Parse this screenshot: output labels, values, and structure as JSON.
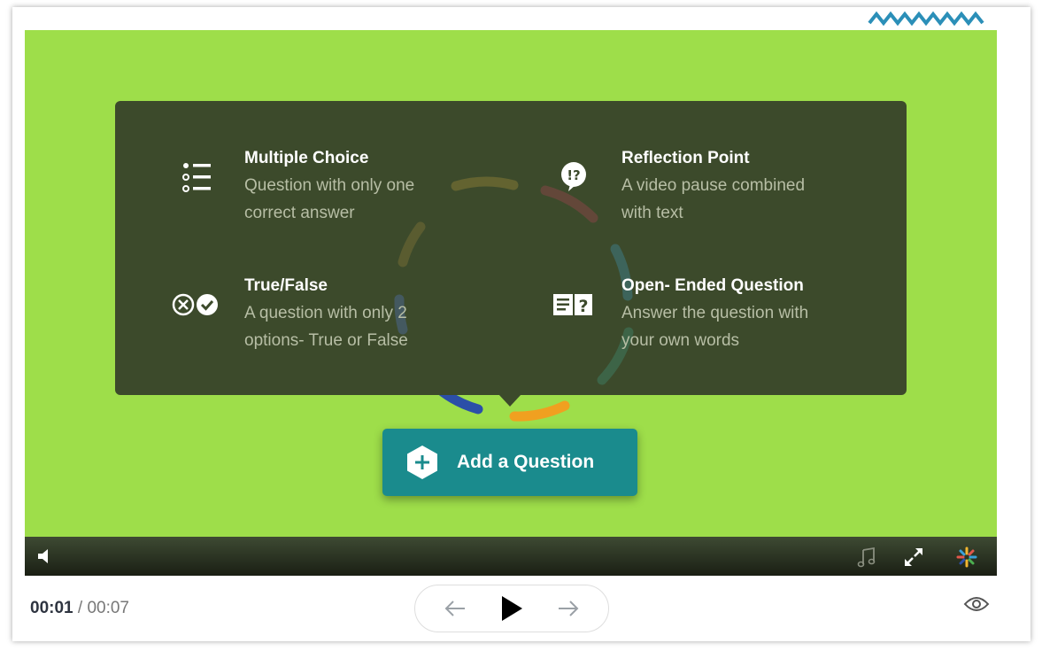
{
  "popup": {
    "options": [
      {
        "title": "Multiple Choice",
        "desc_line1": "Question with only one",
        "desc_line2": "correct answer",
        "icon": "list-icon"
      },
      {
        "title": "Reflection Point",
        "desc_line1": "A video pause combined",
        "desc_line2": "with text",
        "icon": "speech-bubble-icon"
      },
      {
        "title": "True/False",
        "desc_line1": "A question with only 2",
        "desc_line2": "options- True or False",
        "icon": "true-false-icon"
      },
      {
        "title": "Open- Ended Question",
        "desc_line1": "Answer the question with",
        "desc_line2": "your own words",
        "icon": "open-question-icon"
      }
    ]
  },
  "add_button": {
    "label": "Add a Question",
    "icon": "plus-hexagon-icon"
  },
  "player": {
    "current_time": "00:01",
    "separator": "/",
    "total_time": "00:07"
  },
  "colors": {
    "video_bg": "#9ede4a",
    "popup_bg": "#3c4a2b",
    "accent": "#1a8b8d"
  }
}
